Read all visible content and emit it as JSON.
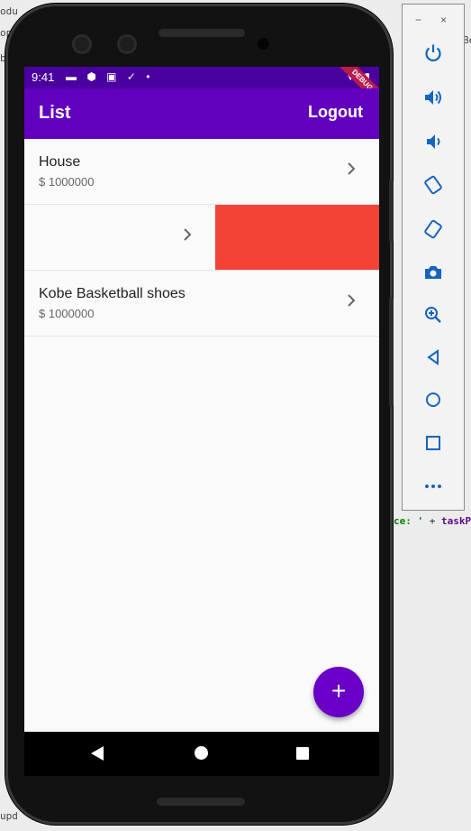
{
  "ide": {
    "fragments": [
      "odu",
      "op",
      "SD",
      "Be",
      "b",
      "upd"
    ],
    "code": {
      "prefix": "ce: ",
      "quote": "'",
      "op": " + ",
      "var": "taskP"
    }
  },
  "status_bar": {
    "time": "9:41",
    "debug_label": "DEBUG"
  },
  "app_bar": {
    "title": "List",
    "logout_label": "Logout"
  },
  "items": [
    {
      "title": "House",
      "subtitle": "$ 1000000"
    },
    {
      "title": "",
      "subtitle": "",
      "state": "swiped",
      "action_color": "#f44336"
    },
    {
      "title": "Kobe Basketball shoes",
      "subtitle": "$ 1000000"
    }
  ],
  "fab": {
    "icon": "add-icon",
    "symbol": "+"
  },
  "colors": {
    "primary": "#6200c0",
    "status_bar": "#4a00a0",
    "fab": "#6a00c8",
    "swipe_action": "#f44336"
  },
  "emulator_toolbar": {
    "window_controls": [
      "−",
      "×"
    ],
    "buttons": [
      "power-icon",
      "volume-up-icon",
      "volume-down-icon",
      "rotate-left-icon",
      "rotate-right-icon",
      "camera-icon",
      "zoom-icon",
      "back-icon",
      "home-icon",
      "overview-icon",
      "more-icon"
    ]
  }
}
